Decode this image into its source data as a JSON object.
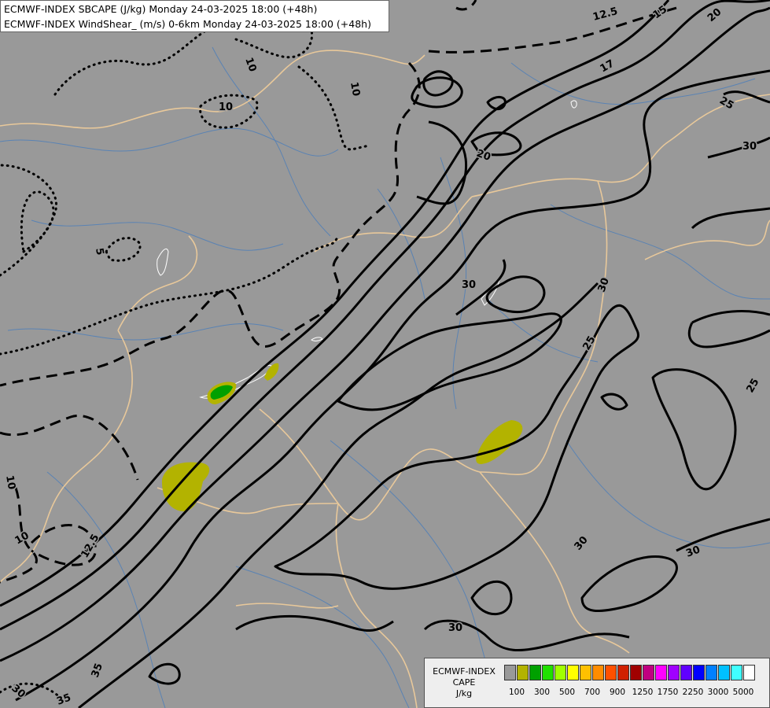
{
  "header": {
    "line1": "ECMWF-INDEX SBCAPE (J/kg) Monday 24-03-2025 18:00 (+48h)",
    "line2": "ECMWF-INDEX WindShear_ (m/s) 0-6km Monday 24-03-2025 18:00 (+48h)"
  },
  "legend": {
    "title1": "ECMWF-INDEX",
    "title2": "CAPE",
    "unit": "J/kg",
    "colors": [
      "#999999",
      "#b3b300",
      "#00a000",
      "#20e000",
      "#a0ff00",
      "#ffff00",
      "#ffc000",
      "#ff8c00",
      "#ff5000",
      "#d02000",
      "#a00000",
      "#c00080",
      "#ff00ff",
      "#a000ff",
      "#6000ff",
      "#0000ff",
      "#0080ff",
      "#00c0ff",
      "#40ffff",
      "#ffffff"
    ],
    "tick_labels": [
      "100",
      "300",
      "500",
      "700",
      "900",
      "1250",
      "1750",
      "2250",
      "3000",
      "5000"
    ]
  },
  "contour_labels": {
    "l_10a": "10",
    "l_10b": "10",
    "l_10c": "10",
    "l_10d": "10",
    "l_10e": "10",
    "l_5": "5",
    "l_125a": "12.5",
    "l_125b": "12.5",
    "l_15": "15",
    "l_17": "17",
    "l_20a": "20",
    "l_20b": "20",
    "l_25a": "25",
    "l_25b": "25",
    "l_25c": "25",
    "l_30a": "30",
    "l_30b": "30",
    "l_30c": "30",
    "l_30d": "30",
    "l_30e": "30",
    "l_30f": "30",
    "l_30g": "30",
    "l_30h": "30",
    "l_35a": "35",
    "l_35b": "35"
  }
}
